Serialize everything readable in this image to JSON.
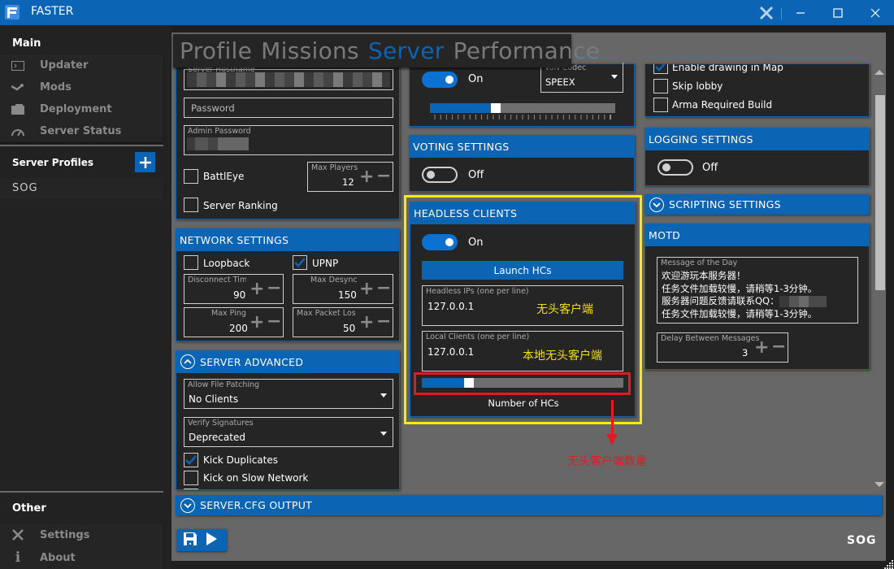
{
  "window": {
    "title": "FASTER",
    "controls": {
      "tools": "wrench-screwdriver",
      "minimize": "—",
      "maximize": "☐",
      "close": "✕"
    }
  },
  "sidebar": {
    "main_heading": "Main",
    "main_items": [
      {
        "label": "Updater",
        "icon": "terminal-icon"
      },
      {
        "label": "Mods",
        "icon": "steam-icon"
      },
      {
        "label": "Deployment",
        "icon": "folder-icon"
      },
      {
        "label": "Server Status",
        "icon": "gauge-icon"
      }
    ],
    "profiles_heading": "Server Profiles",
    "add_profile_label": "+",
    "profiles": [
      {
        "label": "SOG"
      }
    ],
    "other_heading": "Other",
    "other_items": [
      {
        "label": "Settings",
        "icon": "tools-icon"
      },
      {
        "label": "About",
        "icon": "info-icon"
      }
    ]
  },
  "tabs": [
    {
      "label": "Profile",
      "active": false
    },
    {
      "label": "Missions",
      "active": false
    },
    {
      "label": "Server",
      "active": true
    },
    {
      "label": "Performance",
      "active": false
    }
  ],
  "server_settings": {
    "hostname_label": "Server Hostname",
    "hostname_value": "[redacted]",
    "password_placeholder": "Password",
    "admin_password_label": "Admin Password",
    "admin_password_value": "[redacted]",
    "battleye_label": "BattlEye",
    "battleye_checked": false,
    "server_ranking_label": "Server Ranking",
    "server_ranking_checked": false,
    "max_players_label": "Max Players",
    "max_players_value": "12"
  },
  "network_settings": {
    "title": "NETWORK SETTINGS",
    "loopback_label": "Loopback",
    "loopback_checked": false,
    "upnp_label": "UPNP",
    "upnp_checked": true,
    "disconnect_timeout_label": "Disconnect Time",
    "disconnect_timeout_value": "90",
    "max_desync_label": "Max Desync",
    "max_desync_value": "150",
    "max_ping_label": "Max Ping",
    "max_ping_value": "200",
    "max_packet_loss_label": "Max Packet Los",
    "max_packet_loss_value": "50"
  },
  "server_advanced": {
    "title": "SERVER ADVANCED",
    "allow_file_patching_label": "Allow File Patching",
    "allow_file_patching_value": "No Clients",
    "verify_signatures_label": "Verify Signatures",
    "verify_signatures_value": "Deprecated",
    "kick_duplicates_label": "Kick Duplicates",
    "kick_duplicates_checked": true,
    "kick_slow_network_label": "Kick on Slow Network",
    "kick_slow_network_checked": false
  },
  "server_cfg_output": {
    "title": "SERVER.CFG OUTPUT"
  },
  "von": {
    "toggle_label": "On",
    "enabled": true,
    "codec_label": "VoN Codec",
    "codec_value": "SPEEX",
    "quality_fraction": 0.33
  },
  "voting_settings": {
    "title": "VOTING SETTINGS",
    "toggle_label": "Off",
    "enabled": false
  },
  "headless_clients": {
    "title": "HEADLESS CLIENTS",
    "toggle_label": "On",
    "enabled": true,
    "launch_button": "Launch HCs",
    "headless_ips_label": "Headless IPs (one per line)",
    "headless_ips_value": "127.0.0.1",
    "local_clients_label": "Local Clients (one per line)",
    "local_clients_value": "127.0.0.1",
    "number_of_hcs_label": "Number of HCs",
    "number_fraction": 0.21
  },
  "misc_settings": {
    "enable_drawing_label": "Enable drawing in Map",
    "enable_drawing_checked": true,
    "skip_lobby_label": "Skip lobby",
    "skip_lobby_checked": false,
    "arma_required_build_label": "Arma Required Build",
    "arma_required_build_checked": false
  },
  "logging_settings": {
    "title": "LOGGING SETTINGS",
    "toggle_label": "Off",
    "enabled": false
  },
  "scripting_settings": {
    "title": "SCRIPTING SETTINGS"
  },
  "motd": {
    "title": "MOTD",
    "message_label": "Message of the Day",
    "lines": [
      "欢迎游玩本服务器！",
      "任务文件加载较慢，请稍等1-3分钟。",
      "服务器问题反馈请联系QQ：",
      "任务文件加载较慢，请稍等1-3分钟。"
    ],
    "delay_label": "Delay Between Messages",
    "delay_value": "3"
  },
  "annotations": {
    "headless_ips_note": "无头客户端",
    "local_clients_note": "本地无头客户端",
    "hc_count_note": "无头客户端数量",
    "highlight_color": "#f5ee00",
    "arrow_color": "#e11b22"
  },
  "footer": {
    "profile_name": "SOG"
  },
  "colors": {
    "accent": "#0b64b4",
    "panel": "#252525",
    "canvas": "#676767"
  }
}
